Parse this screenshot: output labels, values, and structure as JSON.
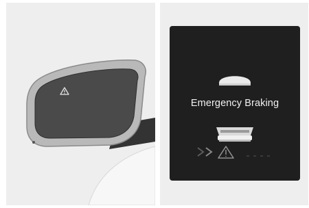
{
  "left_panel": {
    "mirror_icon": "warning-triangle-icon"
  },
  "right_panel": {
    "display_message": "Emergency Braking",
    "icons": [
      "car-front-icon",
      "car-rear-icon",
      "double-chevron-right-icon",
      "warning-triangle-icon"
    ]
  },
  "colors": {
    "panel_background": "#eeeeee",
    "display_background": "#1f1f1f",
    "display_text": "#f2f2f2",
    "mirror_glass": "#4a4a4a",
    "mirror_housing": "#b9b9b9"
  }
}
